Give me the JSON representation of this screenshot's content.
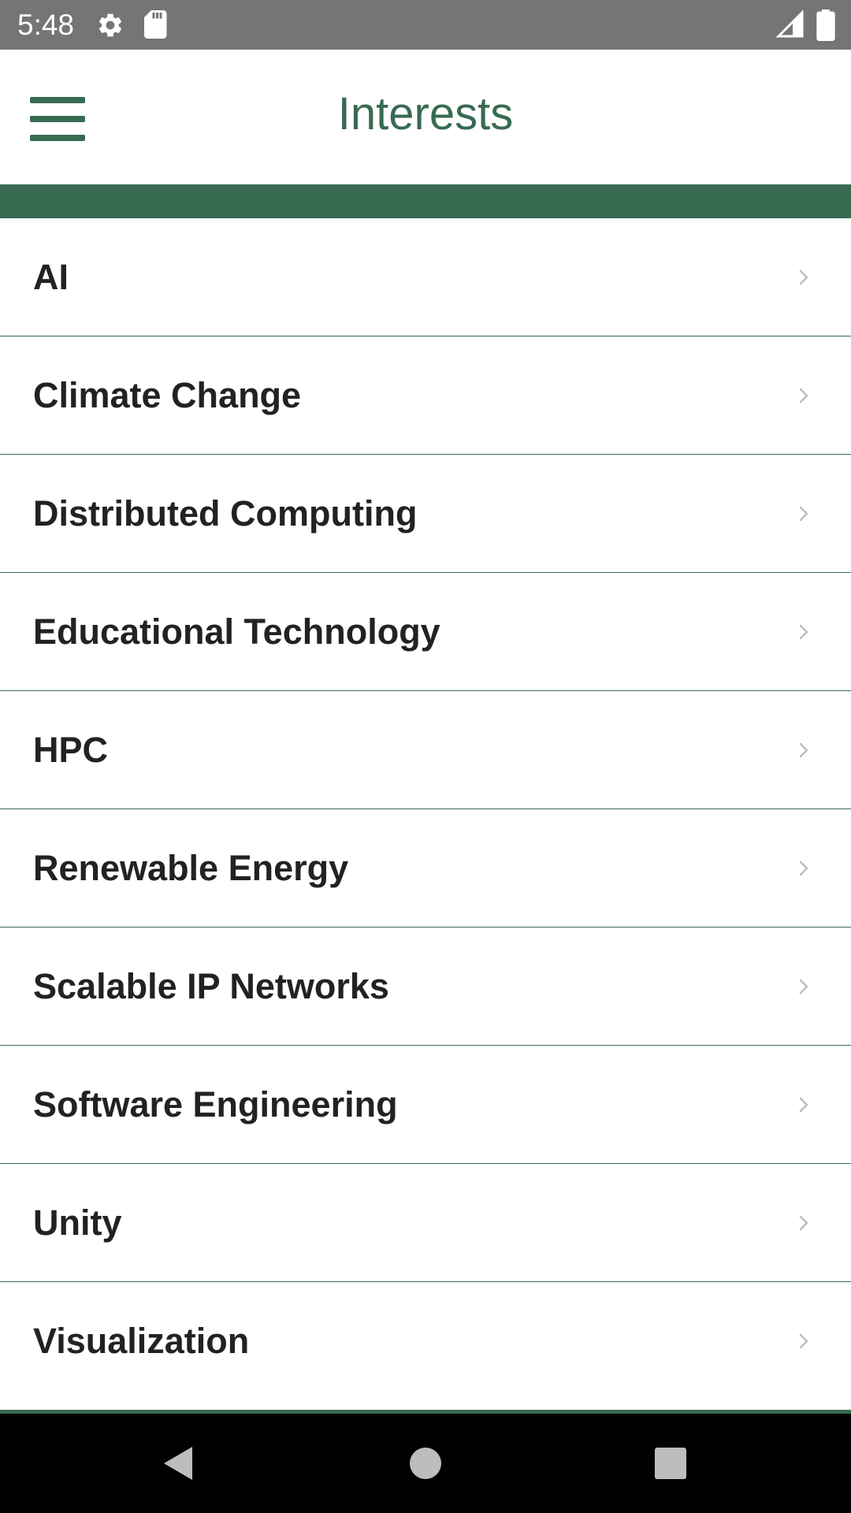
{
  "status_bar": {
    "time": "5:48",
    "icons": [
      "settings-gear-icon",
      "sd-card-icon",
      "signal-icon",
      "battery-icon"
    ]
  },
  "app_bar": {
    "title": "Interests",
    "menu_icon": "hamburger-menu-icon"
  },
  "colors": {
    "accent": "#386a52",
    "status_bar": "#757575",
    "divider": "#3b6b58",
    "text": "#222222",
    "chevron": "#bdbdbd",
    "nav_bar": "#000000"
  },
  "interests": [
    {
      "label": "AI"
    },
    {
      "label": "Climate Change"
    },
    {
      "label": "Distributed Computing"
    },
    {
      "label": "Educational Technology"
    },
    {
      "label": "HPC"
    },
    {
      "label": "Renewable Energy"
    },
    {
      "label": "Scalable IP Networks"
    },
    {
      "label": "Software Engineering"
    },
    {
      "label": "Unity"
    },
    {
      "label": "Visualization"
    }
  ],
  "item_icon": "chevron-right-icon",
  "nav_bar": {
    "buttons": [
      "back-icon",
      "home-icon",
      "recents-icon"
    ]
  }
}
